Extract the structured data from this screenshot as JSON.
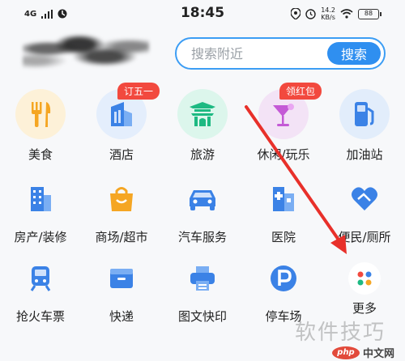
{
  "status": {
    "network": "4G",
    "time": "18:45",
    "speed_value": "14.2",
    "speed_unit": "KB/s",
    "battery": "88"
  },
  "search": {
    "placeholder": "搜索附近",
    "button_label": "搜索"
  },
  "categories": [
    {
      "label": "美食",
      "icon": "fork-knife-icon",
      "badge": ""
    },
    {
      "label": "酒店",
      "icon": "hotel-building-icon",
      "badge": "订五一"
    },
    {
      "label": "旅游",
      "icon": "pagoda-icon",
      "badge": ""
    },
    {
      "label": "休闲/玩乐",
      "icon": "cocktail-icon",
      "badge": "领红包"
    },
    {
      "label": "加油站",
      "icon": "gas-pump-icon",
      "badge": ""
    },
    {
      "label": "房产/装修",
      "icon": "apartment-icon",
      "badge": ""
    },
    {
      "label": "商场/超市",
      "icon": "shopping-bag-icon",
      "badge": ""
    },
    {
      "label": "汽车服务",
      "icon": "car-icon",
      "badge": ""
    },
    {
      "label": "医院",
      "icon": "hospital-icon",
      "badge": ""
    },
    {
      "label": "便民/厕所",
      "icon": "heart-hand-icon",
      "badge": ""
    },
    {
      "label": "抢火车票",
      "icon": "train-icon",
      "badge": ""
    },
    {
      "label": "快递",
      "icon": "parcel-icon",
      "badge": ""
    },
    {
      "label": "图文快印",
      "icon": "printer-icon",
      "badge": ""
    },
    {
      "label": "停车场",
      "icon": "parking-icon",
      "badge": ""
    },
    {
      "label": "更多",
      "icon": "more-dots-icon",
      "badge": ""
    }
  ],
  "watermark": {
    "text": "软件技巧",
    "logo_mark": "php",
    "logo_text": "中文网"
  },
  "colors": {
    "accent": "#2f8ff0",
    "badge": "#f2493e",
    "arrow": "#e8302a"
  }
}
